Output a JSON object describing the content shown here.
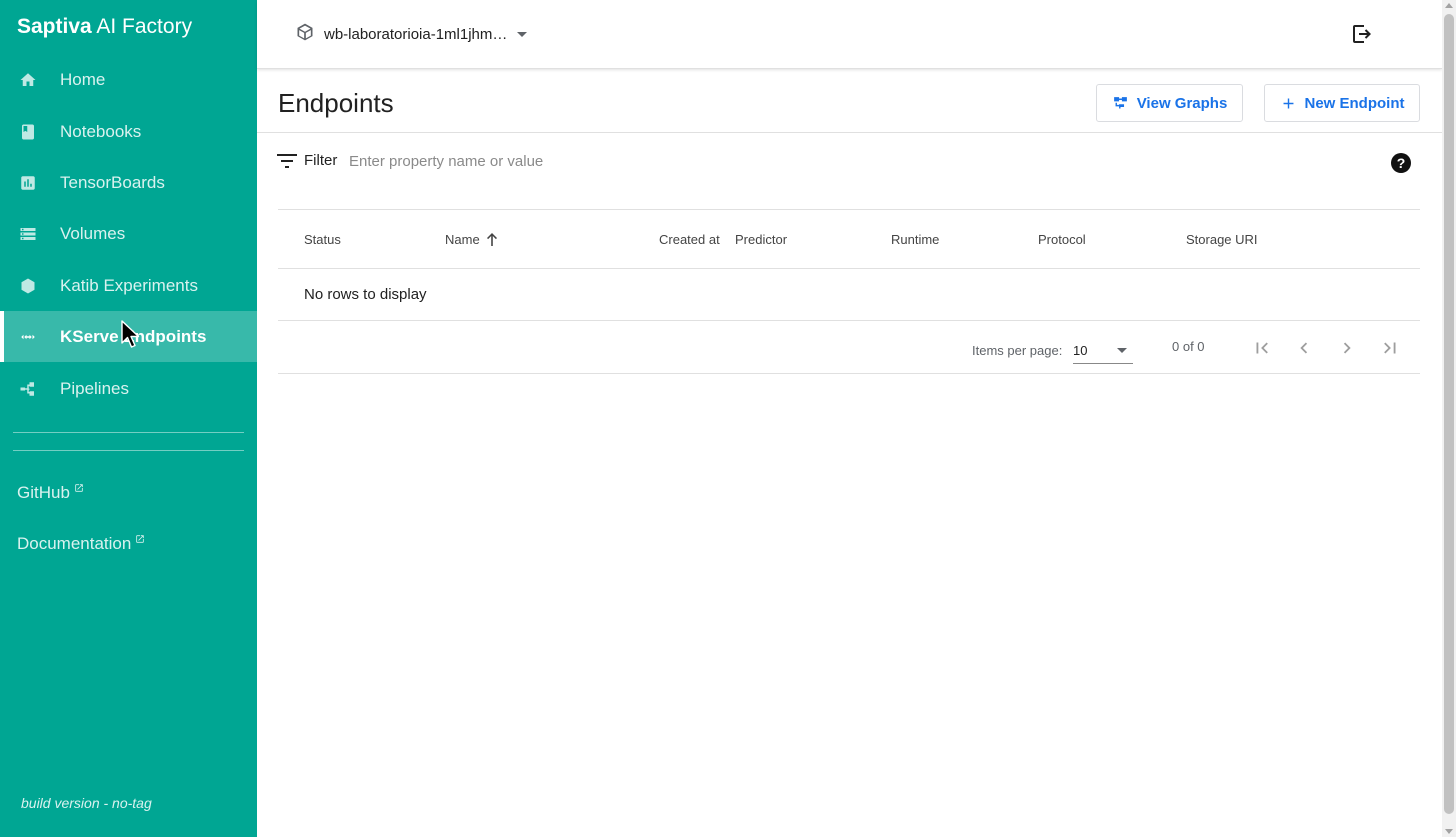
{
  "brand": {
    "strong": "Saptiva",
    "rest": " AI Factory"
  },
  "sidebar": {
    "items": [
      {
        "label": "Home",
        "icon": "home-icon"
      },
      {
        "label": "Notebooks",
        "icon": "notebook-icon"
      },
      {
        "label": "TensorBoards",
        "icon": "bar-chart-icon"
      },
      {
        "label": "Volumes",
        "icon": "storage-icon"
      },
      {
        "label": "Katib Experiments",
        "icon": "katib-icon"
      },
      {
        "label": "KServe Endpoints",
        "icon": "arrows-horizontal-icon",
        "active": true
      },
      {
        "label": "Pipelines",
        "icon": "pipeline-icon"
      }
    ],
    "links": [
      {
        "label": "GitHub",
        "icon": "external-link-icon"
      },
      {
        "label": "Documentation",
        "icon": "external-link-icon"
      }
    ],
    "build": "build version - no-tag"
  },
  "topbar": {
    "namespace": "wb-laboratorioia-1ml1jhm…",
    "namespace_icon": "cube-icon",
    "logout_icon": "logout-icon"
  },
  "page": {
    "title": "Endpoints",
    "view_graphs_label": "View Graphs",
    "new_endpoint_label": "New Endpoint"
  },
  "filter": {
    "label": "Filter",
    "placeholder": "Enter property name or value",
    "help": "?"
  },
  "table": {
    "columns": [
      "Status",
      "Name",
      "Created at",
      "Predictor",
      "Runtime",
      "Protocol",
      "Storage URI"
    ],
    "empty_text": "No rows to display"
  },
  "paginator": {
    "items_per_page_label": "Items per page:",
    "items_per_page": "10",
    "range": "0 of 0"
  },
  "colors": {
    "sidebar_bg": "#00a693",
    "accent": "#1a73e8"
  }
}
